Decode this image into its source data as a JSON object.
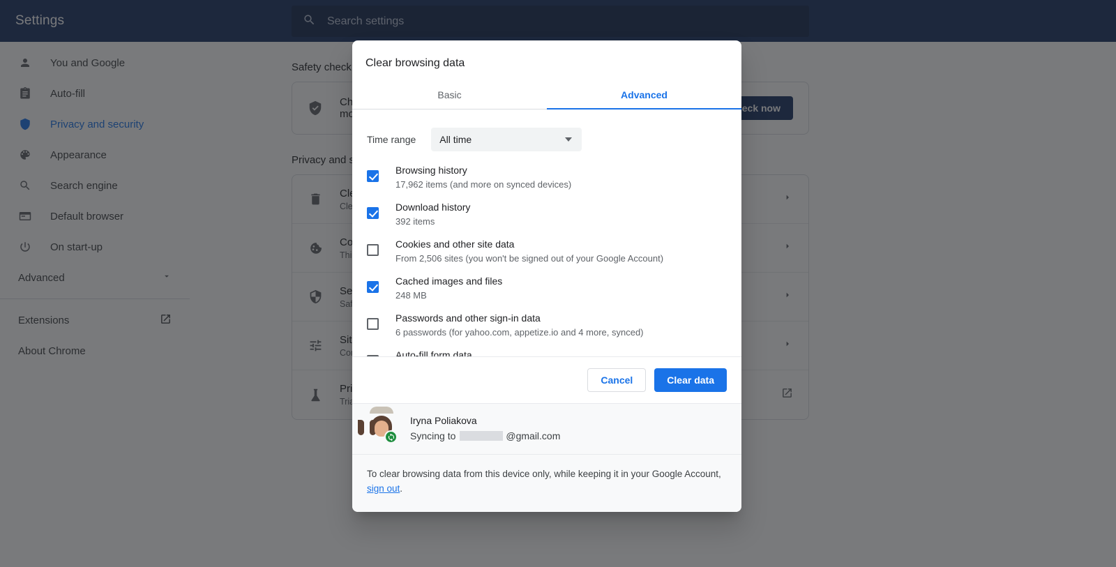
{
  "topbar": {
    "title": "Settings",
    "search_placeholder": "Search settings"
  },
  "sidebar": {
    "items": [
      {
        "label": "You and Google",
        "icon": "person-icon"
      },
      {
        "label": "Auto-fill",
        "icon": "clipboard-icon"
      },
      {
        "label": "Privacy and security",
        "icon": "shield-icon",
        "active": true
      },
      {
        "label": "Appearance",
        "icon": "palette-icon"
      },
      {
        "label": "Search engine",
        "icon": "search-icon"
      },
      {
        "label": "Default browser",
        "icon": "browser-window-icon"
      },
      {
        "label": "On start-up",
        "icon": "power-icon"
      }
    ],
    "advanced": {
      "label": "Advanced",
      "icon": "chevron-down-icon"
    },
    "extensions": {
      "label": "Extensions",
      "icon": "external-link-icon"
    },
    "about": {
      "label": "About Chrome"
    }
  },
  "page": {
    "safety_check": {
      "section_title": "Safety check",
      "row_text": "Chrome can help keep you safe from data breaches, bad extensions and more",
      "button_label": "Check now"
    },
    "privacy": {
      "section_title": "Privacy and security",
      "rows": [
        {
          "icon": "trash-icon",
          "title": "Clear browsing data",
          "sub": "Clear history, cookies, cache and more",
          "end": "chevron-right-icon"
        },
        {
          "icon": "cookie-icon",
          "title": "Cookies and other site data",
          "sub": "Third-party cookies are blocked in Incognito mode",
          "end": "chevron-right-icon"
        },
        {
          "icon": "shield-icon",
          "title": "Security",
          "sub": "Safe Browsing (protection from dangerous sites) and other security settings",
          "end": "chevron-right-icon"
        },
        {
          "icon": "sliders-icon",
          "title": "Site settings",
          "sub": "Controls what information sites can use and show",
          "end": "chevron-right-icon"
        },
        {
          "icon": "flask-icon",
          "title": "Privacy Sandbox",
          "sub": "Trial features are on",
          "end": "external-link-icon"
        }
      ]
    }
  },
  "dialog": {
    "title": "Clear browsing data",
    "tabs": [
      {
        "label": "Basic",
        "active": false
      },
      {
        "label": "Advanced",
        "active": true
      }
    ],
    "time_range": {
      "label": "Time range",
      "value": "All time",
      "arrow": "chevron-down-icon"
    },
    "options": [
      {
        "title": "Browsing history",
        "sub": "17,962 items (and more on synced devices)",
        "checked": true
      },
      {
        "title": "Download history",
        "sub": "392 items",
        "checked": true
      },
      {
        "title": "Cookies and other site data",
        "sub": "From 2,506 sites (you won't be signed out of your Google Account)",
        "checked": false
      },
      {
        "title": "Cached images and files",
        "sub": "248 MB",
        "checked": true
      },
      {
        "title": "Passwords and other sign-in data",
        "sub": "6 passwords (for yahoo.com, appetize.io and 4 more, synced)",
        "checked": false
      },
      {
        "title": "Auto-fill form data",
        "sub": "",
        "checked": false
      }
    ],
    "cancel_label": "Cancel",
    "clear_label": "Clear data",
    "account": {
      "name": "Iryna Poliakova",
      "sync_prefix": "Syncing to",
      "sync_suffix": "@gmail.com",
      "badge": "sync-icon"
    },
    "footer": {
      "text_before": "To clear browsing data from this device only, while keeping it in your Google Account, ",
      "link": "sign out",
      "text_after": "."
    }
  },
  "colors": {
    "accent": "#1a73e8",
    "topbar": "#1a3263",
    "sync_badge": "#1e8e3e"
  }
}
